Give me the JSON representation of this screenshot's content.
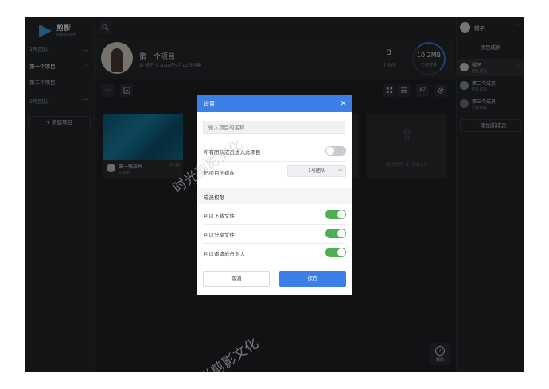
{
  "app": {
    "brand": "剪影",
    "brand_sub": "hiwai.com"
  },
  "sidebar": {
    "teams": [
      {
        "label": "1号团队"
      },
      {
        "label": "2号团队"
      }
    ],
    "projects": [
      {
        "label": "第一个项目",
        "active": true
      },
      {
        "label": "第二个项目",
        "active": false
      }
    ],
    "more_glyph": "···",
    "new_project_label": "+ 新建项目"
  },
  "topbar": {
    "search_icon": "search-icon"
  },
  "project": {
    "title": "第一个项目",
    "meta": "由 帽子 在2018年9月11日创建",
    "file_count": "3",
    "file_count_label": "个文件",
    "storage_value": "10.2MB",
    "storage_label": "已占容量"
  },
  "toolbar": {
    "more_glyph": "···",
    "sort_label": "AZ"
  },
  "files": [
    {
      "name": "第一钱样片",
      "size": "5.1MB",
      "time": "2018"
    }
  ],
  "upload": {
    "text": "拖拽文件 或 点击上传"
  },
  "right_panel": {
    "user_name": "帽子",
    "title": "项目成员",
    "members": [
      {
        "name": "帽子",
        "role": "团队成员",
        "more": "···"
      },
      {
        "name": "第二个成员",
        "role": "团队成员",
        "more": ""
      },
      {
        "name": "第三个成员",
        "role": "外部协作",
        "more": ""
      }
    ],
    "add_member_label": "+ 添加新成员",
    "help_label": "帮助"
  },
  "modal": {
    "title": "设置",
    "close_glyph": "×",
    "name_placeholder": "输入项目的名称",
    "all_members_join_label": "所有团队成员进入此项目",
    "all_members_join": false,
    "create_in_label": "把项目创建在",
    "create_in_value": "1号团队",
    "permissions_label": "成员权限",
    "permissions": [
      {
        "label": "可以下载文件",
        "on": true
      },
      {
        "label": "可以分享文件",
        "on": true
      },
      {
        "label": "可以邀请成员加入",
        "on": true
      }
    ],
    "cancel_label": "取消",
    "save_label": "保存"
  },
  "watermark": "时光剪影文化",
  "colors": {
    "accent": "#3c7fe6",
    "toggle_on": "#4caf50",
    "background": "#1f2124"
  }
}
